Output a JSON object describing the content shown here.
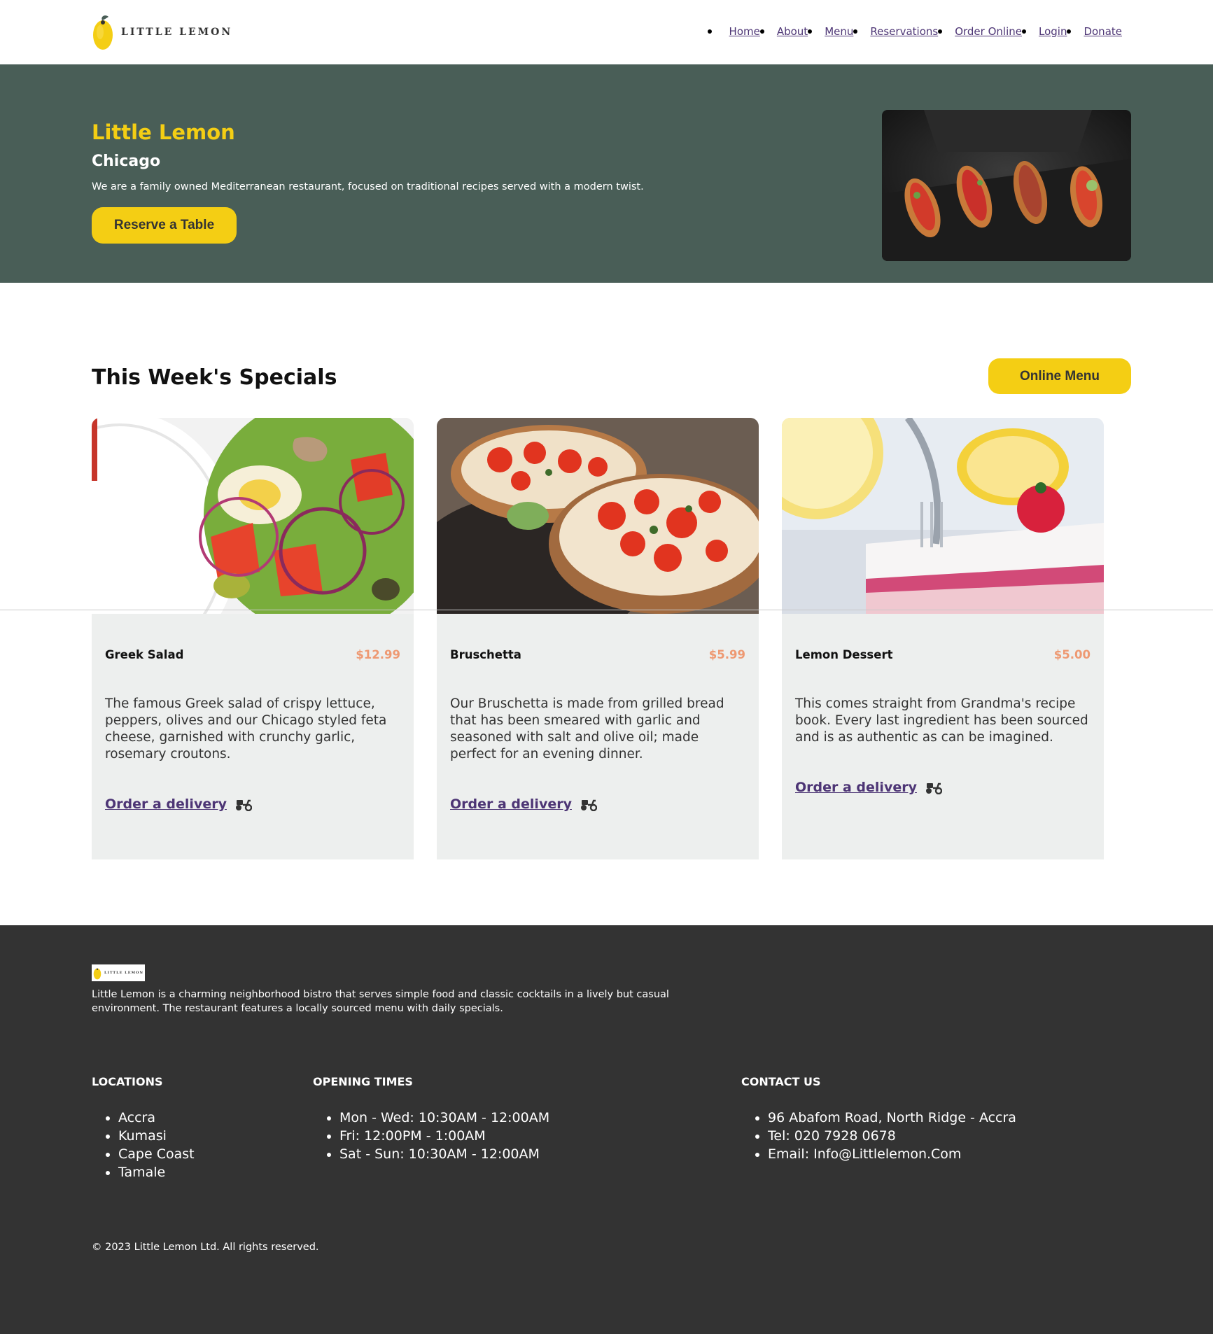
{
  "brand": {
    "logo_text": "LITTLE LEMON"
  },
  "nav": {
    "items": [
      "Home",
      "About",
      "Menu",
      "Reservations",
      "Order Online",
      "Login",
      "Donate"
    ]
  },
  "hero": {
    "title": "Little Lemon",
    "subtitle": "Chicago",
    "description": "We are a family owned Mediterranean restaurant, focused on traditional recipes served with a modern twist.",
    "cta_label": "Reserve a Table",
    "image_icon": "bruschetta-platter-photo"
  },
  "specials": {
    "title": "This Week's Specials",
    "menu_button_label": "Online Menu",
    "cards": [
      {
        "name": "Greek Salad",
        "price": "$12.99",
        "description": "The famous Greek salad of crispy lettuce, peppers, olives and our Chicago styled feta cheese, garnished with crunchy garlic, rosemary croutons.",
        "order_label": "Order a delivery",
        "image_icon": "greek-salad-photo"
      },
      {
        "name": "Bruschetta",
        "price": "$5.99",
        "description": "Our Bruschetta is made from grilled bread that has been smeared with garlic and seasoned with salt and olive oil; made perfect for an evening dinner.",
        "order_label": "Order a delivery",
        "image_icon": "bruschetta-photo"
      },
      {
        "name": "Lemon Dessert",
        "price": "$5.00",
        "description": "This comes straight from Grandma's recipe book. Every last ingredient has been sourced and is as authentic as can be imagined.",
        "order_label": "Order a delivery",
        "image_icon": "lemon-dessert-photo"
      }
    ]
  },
  "footer": {
    "logo_text": "LITTLE LEMON",
    "description": "Little Lemon is a charming neighborhood bistro that serves simple food and classic cocktails in a lively but casual environment. The restaurant features a locally sourced menu with daily specials.",
    "locations": {
      "heading": "LOCATIONS",
      "items": [
        "Accra",
        "Kumasi",
        "Cape Coast",
        "Tamale"
      ]
    },
    "opening_times": {
      "heading": "OPENING TIMES",
      "items": [
        "Mon - Wed: 10:30AM - 12:00AM",
        "Fri: 12:00PM - 1:00AM",
        "Sat - Sun: 10:30AM - 12:00AM"
      ]
    },
    "contact": {
      "heading": "CONTACT US",
      "items": [
        "96 Abafom Road, North Ridge - Accra",
        "Tel: 020 7928 0678",
        "Email: Info@Littlelemon.Com"
      ]
    },
    "copyright": "© 2023 Little Lemon Ltd. All rights reserved."
  },
  "colors": {
    "primary_green": "#495e57",
    "primary_yellow": "#f4ce14",
    "price_orange": "#ee9972",
    "link_purple": "#4d3575",
    "card_bg": "#edefee",
    "footer_bg": "#333333"
  }
}
